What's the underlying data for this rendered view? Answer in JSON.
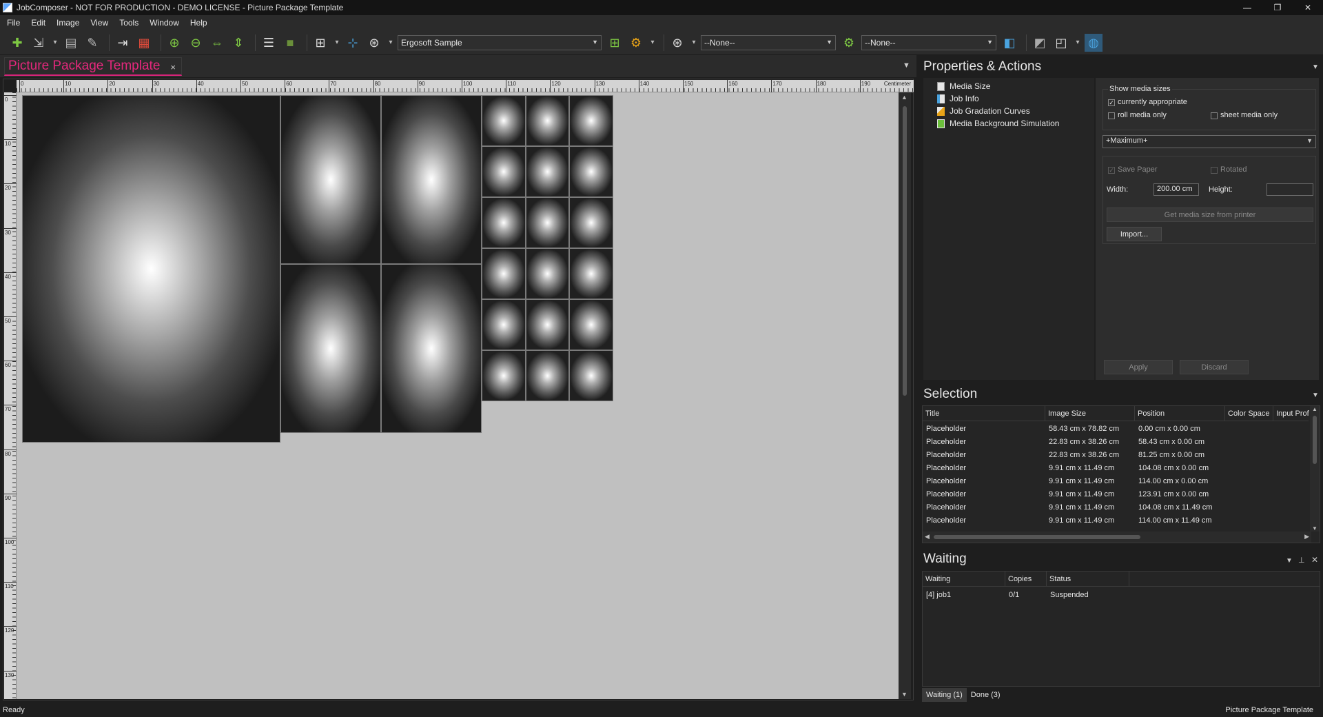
{
  "window": {
    "title": "JobComposer - NOT FOR PRODUCTION - DEMO LICENSE - Picture Package Template",
    "controls": [
      "—",
      "❐",
      "✕"
    ]
  },
  "menu": [
    "File",
    "Edit",
    "Image",
    "View",
    "Tools",
    "Window",
    "Help"
  ],
  "toolbar": {
    "profile_combo": "Ergosoft Sample",
    "filter_combo_1": "--None--",
    "filter_combo_2": "--None--"
  },
  "document_tab": {
    "label": "Picture Package Template",
    "close": "×"
  },
  "ruler": {
    "unit": "Centimeter",
    "top_ticks": [
      "0",
      "10",
      "20",
      "30",
      "40",
      "50",
      "60",
      "70",
      "80",
      "90",
      "100",
      "110",
      "120",
      "130",
      "140",
      "150",
      "160",
      "170",
      "180",
      "190"
    ],
    "left_ticks": [
      "0",
      "10",
      "20",
      "30",
      "40",
      "50",
      "60",
      "70",
      "80",
      "90",
      "100",
      "110",
      "120",
      "130"
    ]
  },
  "properties": {
    "title": "Properties & Actions",
    "tree": [
      {
        "label": "Media Size",
        "icon": "media-size-icon",
        "color": "#e6e6e6"
      },
      {
        "label": "Job Info",
        "icon": "job-info-icon",
        "color": "#4aa3df"
      },
      {
        "label": "Job Gradation Curves",
        "icon": "gradation-curves-icon",
        "color": "#e8a317"
      },
      {
        "label": "Media Background Simulation",
        "icon": "media-background-icon",
        "color": "#6cbf3c"
      }
    ],
    "show_media_sizes": {
      "legend": "Show media sizes",
      "currently_appropriate": "currently appropriate",
      "roll_media_only": "roll media only",
      "sheet_media_only": "sheet media only"
    },
    "media_combo": "+Maximum+",
    "save_paper": "Save Paper",
    "rotated": "Rotated",
    "width_label": "Width:",
    "width_value": "200.00 cm",
    "height_label": "Height:",
    "height_value": "",
    "get_media_size": "Get media size from printer",
    "import": "Import...",
    "apply": "Apply",
    "discard": "Discard"
  },
  "selection": {
    "title": "Selection",
    "columns": [
      "Title",
      "Image Size",
      "Position",
      "Color Space",
      "Input Prof"
    ],
    "rows": [
      [
        "Placeholder",
        "58.43 cm x 78.82 cm",
        "0.00 cm x 0.00 cm"
      ],
      [
        "Placeholder",
        "22.83 cm x 38.26 cm",
        "58.43 cm x 0.00 cm"
      ],
      [
        "Placeholder",
        "22.83 cm x 38.26 cm",
        "81.25 cm x 0.00 cm"
      ],
      [
        "Placeholder",
        "9.91 cm x 11.49 cm",
        "104.08 cm x 0.00 cm"
      ],
      [
        "Placeholder",
        "9.91 cm x 11.49 cm",
        "114.00 cm x 0.00 cm"
      ],
      [
        "Placeholder",
        "9.91 cm x 11.49 cm",
        "123.91 cm x 0.00 cm"
      ],
      [
        "Placeholder",
        "9.91 cm x 11.49 cm",
        "104.08 cm x 11.49 cm"
      ],
      [
        "Placeholder",
        "9.91 cm x 11.49 cm",
        "114.00 cm x 11.49 cm"
      ]
    ]
  },
  "waiting": {
    "title": "Waiting",
    "columns": [
      "Waiting",
      "Copies",
      "Status"
    ],
    "rows": [
      [
        "[4]  job1",
        "0/1",
        "Suspended"
      ]
    ],
    "tabs": [
      "Waiting (1)",
      "Done (3)"
    ]
  },
  "status": {
    "left": "Ready",
    "right": "Picture Package Template"
  }
}
